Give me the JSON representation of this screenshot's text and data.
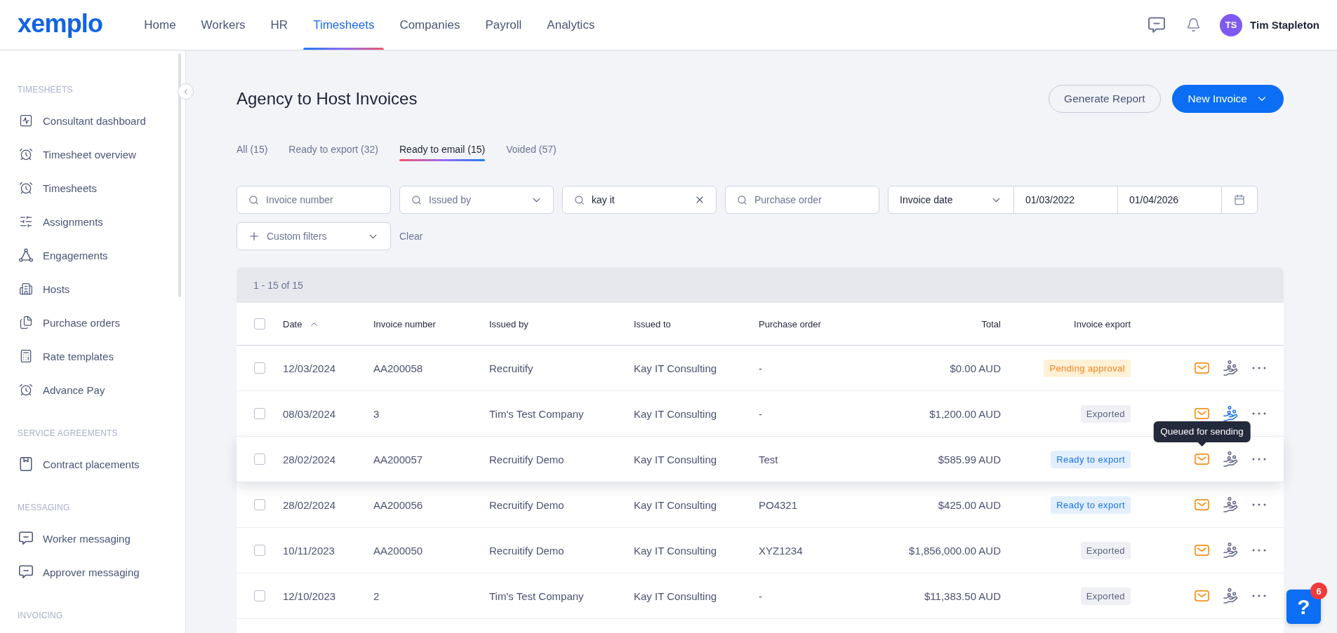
{
  "top_nav": {
    "logo": "xemplo",
    "items": [
      {
        "label": "Home",
        "selected": false
      },
      {
        "label": "Workers",
        "selected": false
      },
      {
        "label": "HR",
        "selected": false
      },
      {
        "label": "Timesheets",
        "selected": true
      },
      {
        "label": "Companies",
        "selected": false
      },
      {
        "label": "Payroll",
        "selected": false
      },
      {
        "label": "Analytics",
        "selected": false
      }
    ],
    "user": {
      "initials": "TS",
      "name": "Tim Stapleton"
    }
  },
  "sidebar": {
    "sections": [
      {
        "heading": "TIMESHEETS",
        "items": [
          {
            "label": "Consultant dashboard",
            "selected": false
          },
          {
            "label": "Timesheet overview",
            "selected": false
          },
          {
            "label": "Timesheets",
            "selected": false
          },
          {
            "label": "Assignments",
            "selected": false
          },
          {
            "label": "Engagements",
            "selected": false
          },
          {
            "label": "Hosts",
            "selected": false
          },
          {
            "label": "Purchase orders",
            "selected": false
          },
          {
            "label": "Rate templates",
            "selected": false
          },
          {
            "label": "Advance Pay",
            "selected": false
          }
        ]
      },
      {
        "heading": "SERVICE AGREEMENTS",
        "items": [
          {
            "label": "Contract placements",
            "selected": false
          }
        ]
      },
      {
        "heading": "MESSAGING",
        "items": [
          {
            "label": "Worker messaging",
            "selected": false
          },
          {
            "label": "Approver messaging",
            "selected": false
          }
        ]
      },
      {
        "heading": "INVOICING"
      }
    ]
  },
  "page": {
    "title": "Agency to Host Invoices",
    "actions": [
      {
        "label": "Generate Report",
        "kind": "secondary"
      },
      {
        "label": "New Invoice",
        "kind": "primary"
      }
    ]
  },
  "tabs": [
    {
      "label": "All (15)",
      "selected": false
    },
    {
      "label": "Ready to export (32)",
      "selected": false
    },
    {
      "label": "Ready to email (15)",
      "selected": true
    },
    {
      "label": "Voided (57)",
      "selected": false
    }
  ],
  "filters": [
    {
      "kind": "search",
      "placeholder": "Invoice number"
    },
    {
      "kind": "select",
      "placeholder": "Issued by"
    },
    {
      "kind": "search",
      "value": "kay it"
    },
    {
      "kind": "search",
      "placeholder": "Purchase order"
    },
    {
      "kind": "date-range",
      "field": "Invoice date",
      "from": "01/03/2022",
      "to": "01/04/2026"
    },
    {
      "kind": "custom",
      "label": "Custom filters"
    }
  ],
  "clear_filters": "Clear",
  "table": {
    "summary": "1 - 15 of 15",
    "select_all_checked": false,
    "columns": [
      {
        "label": "Date",
        "sorted": true
      },
      {
        "label": "Invoice number",
        "sorted": false
      },
      {
        "label": "Issued by",
        "sorted": false
      },
      {
        "label": "Issued to",
        "sorted": false
      },
      {
        "label": "Purchase order",
        "sorted": false
      },
      {
        "label": "Total",
        "sorted": false
      },
      {
        "label": "Invoice export",
        "sorted": false
      }
    ],
    "rows": [
      {
        "checked": false,
        "hovered": false,
        "date": "12/03/2024",
        "invoice_number": "AA200058",
        "issued_by": "Recruitify",
        "issued_to": "Kay IT Consulting",
        "purchase_order": "-",
        "total": "$0.00 AUD",
        "export_status": {
          "label": "Pending approval",
          "kind": "pending"
        },
        "payment_highlighted": false
      },
      {
        "checked": false,
        "hovered": false,
        "date": "08/03/2024",
        "invoice_number": "3",
        "issued_by": "Tim's Test Company",
        "issued_to": "Kay IT Consulting",
        "purchase_order": "-",
        "total": "$1,200.00 AUD",
        "export_status": {
          "label": "Exported",
          "kind": "exported"
        },
        "payment_highlighted": true
      },
      {
        "checked": false,
        "hovered": true,
        "date": "28/02/2024",
        "invoice_number": "AA200057",
        "issued_by": "Recruitify Demo",
        "issued_to": "Kay IT Consulting",
        "purchase_order": "Test",
        "total": "$585.99 AUD",
        "export_status": {
          "label": "Ready to export",
          "kind": "ready"
        },
        "payment_highlighted": false,
        "mail_tooltip": "Queued for sending"
      },
      {
        "checked": false,
        "hovered": false,
        "date": "28/02/2024",
        "invoice_number": "AA200056",
        "issued_by": "Recruitify Demo",
        "issued_to": "Kay IT Consulting",
        "purchase_order": "PO4321",
        "total": "$425.00 AUD",
        "export_status": {
          "label": "Ready to export",
          "kind": "ready"
        },
        "payment_highlighted": false
      },
      {
        "checked": false,
        "hovered": false,
        "date": "10/11/2023",
        "invoice_number": "AA200050",
        "issued_by": "Recruitify Demo",
        "issued_to": "Kay IT Consulting",
        "purchase_order": "XYZ1234",
        "total": "$1,856,000.00 AUD",
        "export_status": {
          "label": "Exported",
          "kind": "exported"
        },
        "payment_highlighted": false
      },
      {
        "checked": false,
        "hovered": false,
        "date": "12/10/2023",
        "invoice_number": "2",
        "issued_by": "Tim's Test Company",
        "issued_to": "Kay IT Consulting",
        "purchase_order": "-",
        "total": "$11,383.50 AUD",
        "export_status": {
          "label": "Exported",
          "kind": "exported"
        },
        "payment_highlighted": false
      }
    ]
  },
  "help": {
    "label": "?",
    "badge": "6"
  }
}
